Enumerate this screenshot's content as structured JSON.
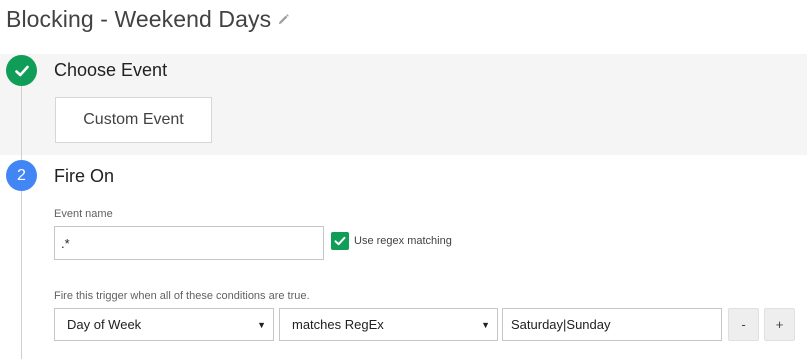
{
  "page": {
    "title": "Blocking - Weekend Days",
    "title_edit_icon": "pencil-icon"
  },
  "step1": {
    "title": "Choose Event",
    "status_icon": "check-icon",
    "event_button_label": "Custom Event"
  },
  "step2": {
    "number": "2",
    "title": "Fire On",
    "event_name_label": "Event name",
    "event_name_value": ".*",
    "regex_checkbox_label": "Use regex matching",
    "regex_checked": true,
    "conditions_label": "Fire this trigger when all of these conditions are true.",
    "condition": {
      "variable": "Day of Week",
      "operator": "matches RegEx",
      "value": "Saturday|Sunday"
    },
    "remove_label": "-",
    "add_label": "+"
  },
  "colors": {
    "step_complete": "#0f9d58",
    "step_active": "#4285f4",
    "checkbox": "#0f9d58",
    "step1_background": "#f5f5f5"
  }
}
